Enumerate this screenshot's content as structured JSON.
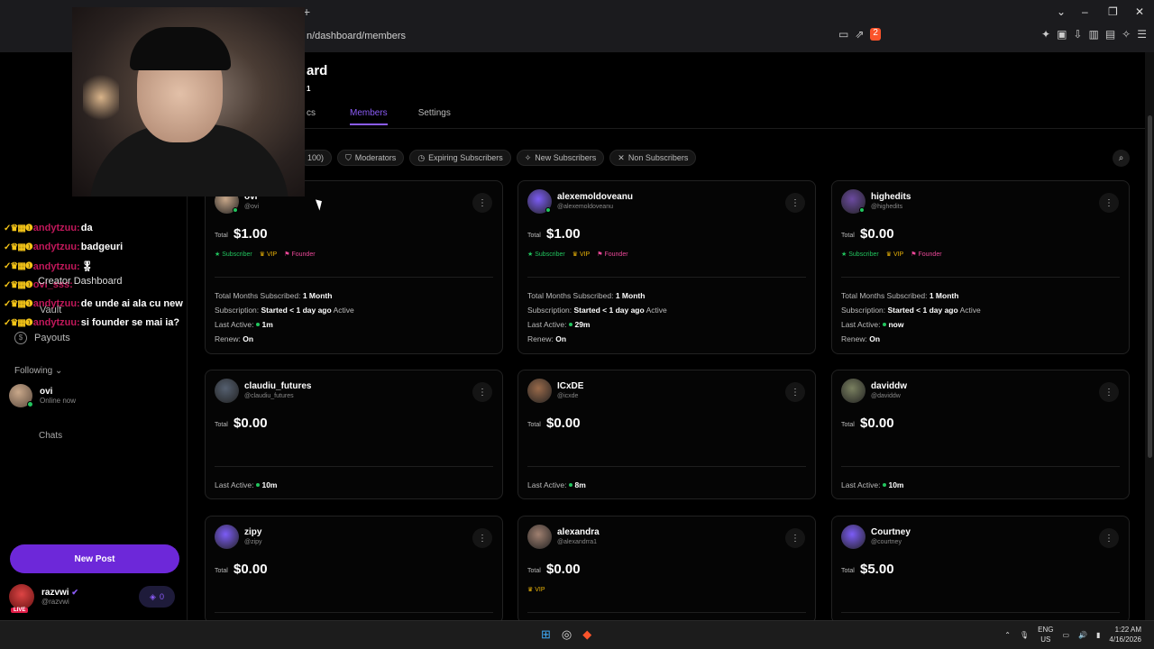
{
  "browser": {
    "url": "n/dashboard/members",
    "new_tab": "+",
    "window_controls": [
      "⌄",
      "–",
      "❐",
      "✕"
    ],
    "addr_icons": [
      "▭",
      "⇗"
    ],
    "brave_badge": "2",
    "tool_icons": [
      "✦",
      "▣",
      "⇩",
      "▥",
      "▤",
      "✧",
      "☰"
    ]
  },
  "sidebar": {
    "chats": "Chats",
    "creator_dashboard": "Creator Dashboard",
    "vault": "Vault",
    "payouts": "Payouts",
    "following_label": "Following",
    "following_user": {
      "name": "ovi",
      "status": "Online now"
    },
    "new_post": "New Post",
    "me": {
      "name": "razvwi",
      "handle": "@razvwi",
      "badge_count": "0",
      "live": "LIVE"
    }
  },
  "chat_overlay": [
    {
      "user": "andytzuu:",
      "message": "da"
    },
    {
      "user": "andytzuu:",
      "message": "badgeuri"
    },
    {
      "user": "andytzuu:",
      "message": "🎖"
    },
    {
      "user": "ovi_sss:",
      "message": ""
    },
    {
      "user": "andytzuu:",
      "message": "de unde ai ala cu new"
    },
    {
      "user": "andytzuu:",
      "message": "si founder se mai ia?"
    }
  ],
  "header": {
    "title": "ard",
    "subtitle": "1",
    "tabs": [
      "cs",
      "Members",
      "Settings"
    ]
  },
  "filters": [
    "100)",
    "Moderators",
    "Expiring Subscribers",
    "New Subscribers",
    "Non Subscribers"
  ],
  "labels": {
    "total": "Total",
    "months": "Total Months Subscribed:",
    "subscription": "Subscription:",
    "last_active": "Last Active:",
    "renew": "Renew:",
    "subscriber": "Subscriber",
    "vip": "VIP",
    "founder": "Founder"
  },
  "members": [
    {
      "name": "ovi",
      "handle": "@ovi",
      "total": "$1.00",
      "months": "1 Month",
      "started": "Started < 1 day ago",
      "state": "Active",
      "last_active": "1m",
      "renew": "On",
      "color": "#c9a88a"
    },
    {
      "name": "alexemoldoveanu",
      "handle": "@alexemoldoveanu",
      "total": "$1.00",
      "months": "1 Month",
      "started": "Started < 1 day ago",
      "state": "Active",
      "last_active": "29m",
      "renew": "On",
      "color": "#7c5cf6"
    },
    {
      "name": "highedits",
      "handle": "@highedits",
      "total": "$0.00",
      "months": "1 Month",
      "started": "Started < 1 day ago",
      "state": "Active",
      "last_active": "now",
      "renew": "On",
      "color": "#6b4aa0"
    },
    {
      "name": "claudiu_futures",
      "handle": "@claudiu_futures",
      "total": "$0.00",
      "last_active": "10m",
      "color": "#556070"
    },
    {
      "name": "ICxDE",
      "handle": "@icxde",
      "total": "$0.00",
      "last_active": "8m",
      "color": "#9a6a4a"
    },
    {
      "name": "daviddw",
      "handle": "@daviddw",
      "total": "$0.00",
      "last_active": "10m",
      "color": "#7a8060"
    },
    {
      "name": "zipy",
      "handle": "@zipy",
      "total": "$0.00",
      "color": "#7c5cf6"
    },
    {
      "name": "alexandra",
      "handle": "@alexandrra1",
      "total": "$0.00",
      "vip": "VIP",
      "color": "#a08070"
    },
    {
      "name": "Courtney",
      "handle": "@courtney",
      "total": "$5.00",
      "color": "#7c5cf6"
    }
  ],
  "taskbar": {
    "lang1": "ENG",
    "lang2": "US",
    "time": "1:22 AM",
    "date": "4/16/2026"
  }
}
